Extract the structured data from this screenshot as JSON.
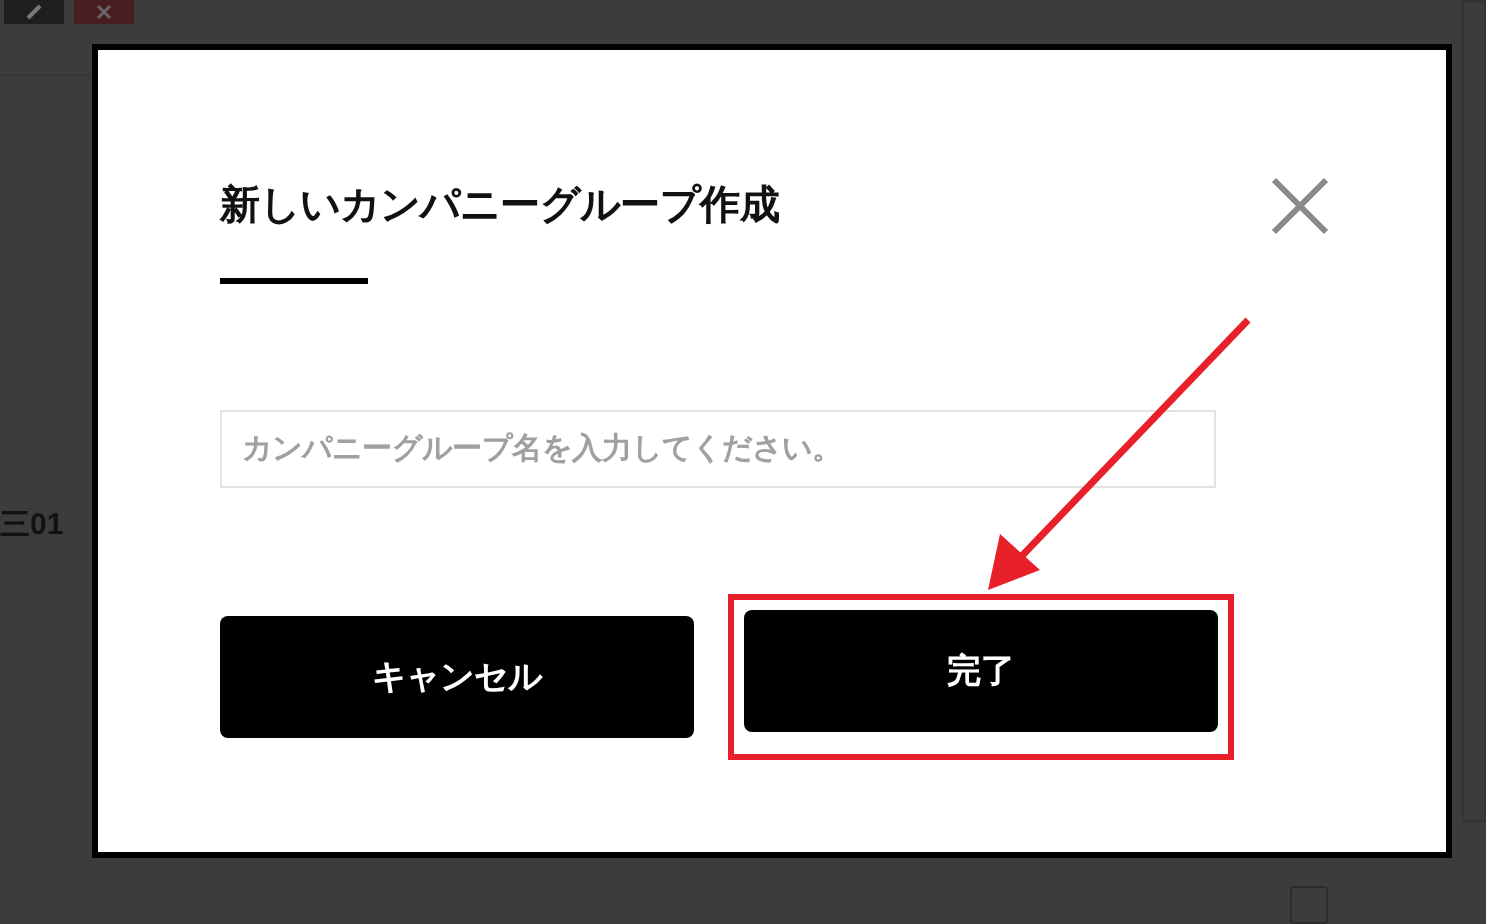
{
  "background": {
    "row_label": "三01",
    "checkbox": {
      "checked": false
    }
  },
  "dialog": {
    "title": "新しいカンパニーグループ作成",
    "name_field": {
      "placeholder": "カンパニーグループ名を入力してください。"
    },
    "cancel_button": {
      "label": "キャンセル",
      "annotated": false
    },
    "done_button": {
      "label": "完了",
      "annotated": true
    }
  }
}
